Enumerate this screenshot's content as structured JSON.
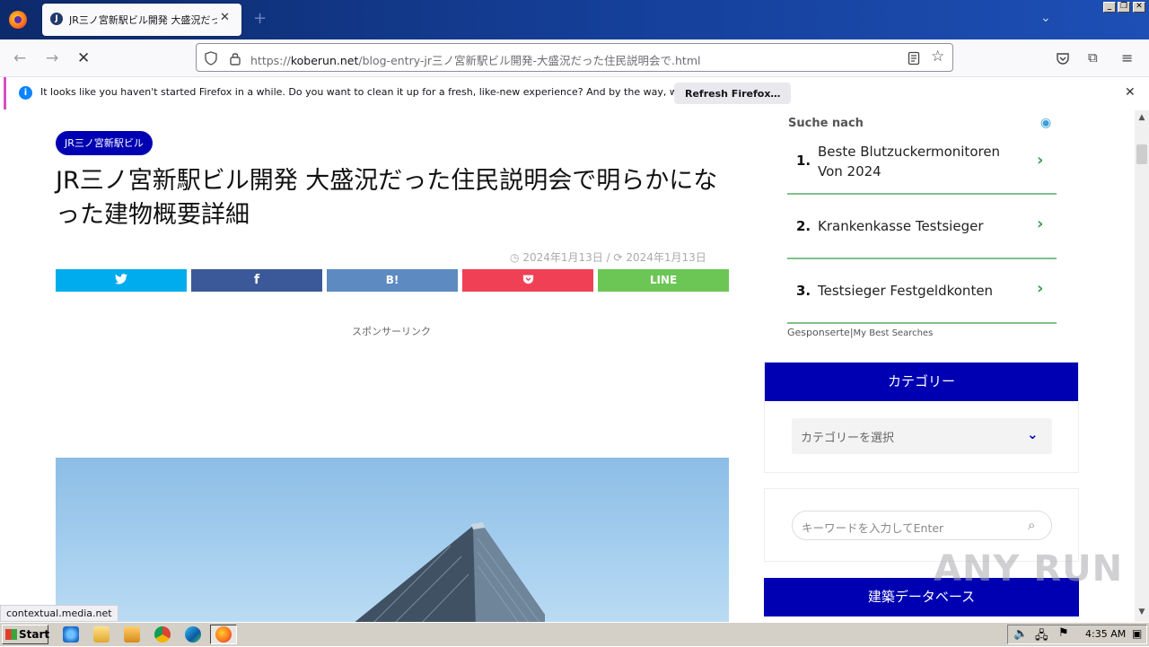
{
  "browser": {
    "tab": {
      "title": "JR三ノ宮新駅ビル開発 大盛況だっ",
      "favicon_letter": "J"
    },
    "url": {
      "scheme": "https://",
      "host": "koberun.net",
      "path": "/blog-entry-jr三ノ宮新駅ビル開発-大盛況だった住民説明会で.html"
    },
    "notification": {
      "text": "It looks like you haven't started Firefox in a while. Do you want to clean it up for a fresh, like-new experience? And by the way, welcome back!",
      "button": "Refresh Firefox…"
    },
    "status_url": "contextual.media.net"
  },
  "article": {
    "category": "JR三ノ宮新駅ビル",
    "title": "JR三ノ宮新駅ビル開発 大盛況だった住民説明会で明らかになった建物概要詳細",
    "published": "2024年1月13日",
    "updated": "2024年1月13日",
    "share": {
      "hatena": "B!",
      "line": "LINE"
    },
    "sponsor_label": "スポンサーリンク"
  },
  "sidebar": {
    "search_heading": "Suche nach",
    "results": [
      {
        "num": "1.",
        "text": "Beste Blutzuckermonitoren Von 2024"
      },
      {
        "num": "2.",
        "text": "Krankenkasse Testsieger"
      },
      {
        "num": "3.",
        "text": "Testsieger Festgeldkonten"
      }
    ],
    "sponsored": "Gesponserte",
    "mbs": "My Best Searches",
    "category_widget": {
      "title": "カテゴリー",
      "select": "カテゴリーを選択"
    },
    "keyword_widget": {
      "placeholder": "キーワードを入力してEnter"
    },
    "building_db": "建築データベース"
  },
  "watermark": "ANY RUN",
  "taskbar": {
    "start": "Start",
    "clock": "4:35 AM"
  },
  "colors": {
    "accent_blue": "#0000b3",
    "twitter": "#00aced",
    "facebook": "#3b5998",
    "hatena": "#5d8ac1",
    "pocket": "#ef4056",
    "line": "#6cc655",
    "ad_green": "#3a9f4e"
  }
}
